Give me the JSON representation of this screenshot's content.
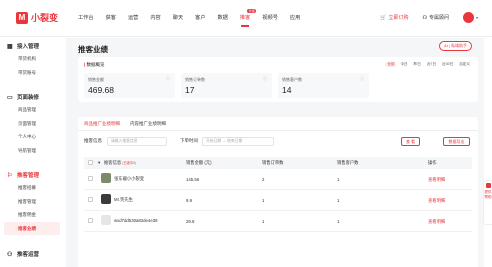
{
  "app": {
    "logo_text": "小裂变"
  },
  "nav": [
    {
      "label": "工作台",
      "active": false
    },
    {
      "label": "获客",
      "active": false
    },
    {
      "label": "运营",
      "active": false
    },
    {
      "label": "内容",
      "active": false
    },
    {
      "label": "聊天",
      "active": false
    },
    {
      "label": "客户",
      "active": false
    },
    {
      "label": "数据",
      "active": false
    },
    {
      "label": "推客",
      "active": true,
      "badge": "升级"
    },
    {
      "label": "视频号",
      "active": false
    },
    {
      "label": "应用",
      "active": false
    }
  ],
  "top_right": {
    "order_label": "立即订购",
    "advisor_label": "专属顾问"
  },
  "sidebar": {
    "groups": [
      {
        "title": "接入管理",
        "icon": "grid-icon",
        "items": [
          "带货机构",
          "带货账号"
        ]
      },
      {
        "title": "页面装修",
        "icon": "page-icon",
        "items": [
          "商品管理",
          "页面管理",
          "个人中心",
          "导航管理"
        ]
      },
      {
        "title": "推客管理",
        "icon": "user-share-icon",
        "items": [
          "推客招募",
          "推客管理",
          "推客佣金",
          "推客业绩"
        ]
      },
      {
        "title": "推客运营",
        "icon": "person-icon",
        "items": []
      }
    ],
    "active_item": "推客业绩"
  },
  "page": {
    "title": "推客业绩",
    "ai_button": "AI | 私域助手"
  },
  "overview": {
    "title_mark": "|",
    "title": "数据概览",
    "ranges": [
      "全部",
      "今日",
      "昨日",
      "近7日",
      "近30日",
      "自定义"
    ],
    "active_range": "全部",
    "metrics": [
      {
        "label": "销售金额",
        "value": "469.68"
      },
      {
        "label": "销售订单数",
        "value": "17"
      },
      {
        "label": "销售客户数",
        "value": "14"
      }
    ]
  },
  "tabs": [
    "商品推广业绩明细",
    "内容推广业绩明细"
  ],
  "filters": {
    "info_label": "推客信息",
    "info_placeholder": "请输入推客信息",
    "time_label": "下单时间",
    "start_placeholder": "开始日期",
    "separator": "→",
    "end_placeholder": "结束日期",
    "search_button": "查 看",
    "export_button": "数据导出"
  },
  "table": {
    "columns": [
      "推客信息",
      "销售金额 (元)",
      "销售订单数",
      "销售客户数",
      "操作"
    ],
    "column_hint": "(已选中0)",
    "sort_icon": "▾",
    "rows": [
      {
        "name": "张东疆小小裂变",
        "amount": "145.56",
        "orders": "2",
        "customers": "1",
        "action": "查看明细"
      },
      {
        "name": "Mr.笑先生",
        "amount": "9.9",
        "orders": "1",
        "customers": "1",
        "action": "查看明细"
      },
      {
        "name": "wxd7dd530a82de4e38",
        "amount": "29.9",
        "orders": "1",
        "customers": "1",
        "action": "查看明细"
      }
    ]
  },
  "float_side": {
    "label": "提供帮助"
  },
  "colors": {
    "accent": "#e8383d",
    "bg": "#f5f6f8"
  }
}
